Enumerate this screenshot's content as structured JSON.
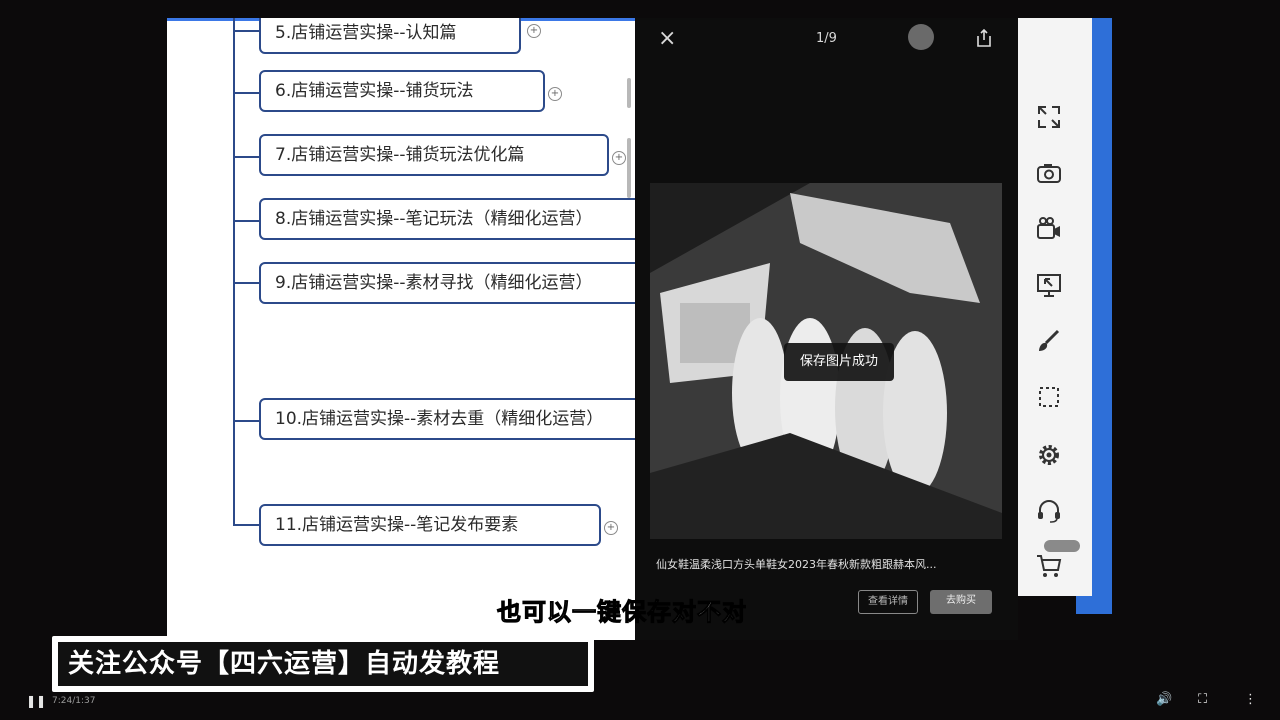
{
  "mindmap": {
    "nodes": [
      {
        "label": "5.店铺运营实操--认知篇"
      },
      {
        "label": "6.店铺运营实操--铺货玩法"
      },
      {
        "label": "7.店铺运营实操--铺货玩法优化篇"
      },
      {
        "label": "8.店铺运营实操--笔记玩法（精细化运营）"
      },
      {
        "label": "9.店铺运营实操--素材寻找（精细化运营）"
      },
      {
        "label": "10.店铺运营实操--素材去重（精细化运营）"
      },
      {
        "label": "11.店铺运营实操--笔记发布要素"
      }
    ],
    "expand_symbol": "+"
  },
  "viewer": {
    "close_symbol": "×",
    "page_counter": "1/9",
    "toast": "保存图片成功",
    "caption": "仙女鞋温柔浅口方头单鞋女2023年春秋新款粗跟赫本风...",
    "view_detail_label": "查看详情",
    "buy_label": "去购买"
  },
  "toolbar": {
    "icons": [
      "fullscreen-icon",
      "camera-icon",
      "video-camera-icon",
      "screen-share-icon",
      "brush-icon",
      "selection-icon",
      "gear-icon",
      "headset-icon",
      "cart-icon"
    ]
  },
  "overlay": {
    "subtitle": "也可以一键保存对不对",
    "banner": "关注公众号【四六运营】自动发教程"
  },
  "player": {
    "time": "7:24/1:37"
  },
  "colors": {
    "node_border": "#2c4a8a",
    "accent_blue": "#2e6fd8",
    "viewer_bg": "#0d0d0d"
  }
}
